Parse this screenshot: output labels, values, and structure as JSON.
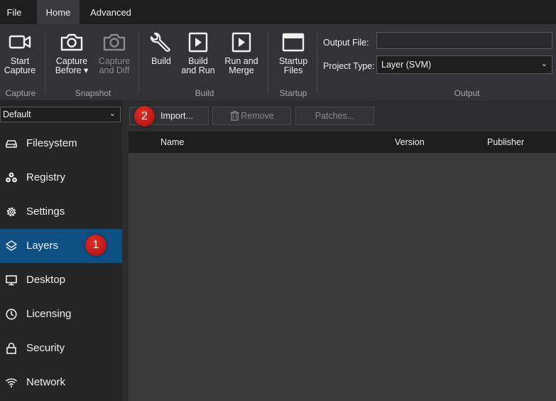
{
  "menu": {
    "tabs": [
      "File",
      "Home",
      "Advanced"
    ]
  },
  "ribbon": {
    "capture": {
      "start_line1": "Start",
      "start_line2": "Capture",
      "group": "Capture"
    },
    "snapshot": {
      "before_line1": "Capture",
      "before_line2": "Before ▾",
      "diff_line1": "Capture",
      "diff_line2": "and Diff",
      "group": "Snapshot"
    },
    "build": {
      "build": "Build",
      "build_run_line1": "Build",
      "build_run_line2": "and Run",
      "run_merge_line1": "Run and",
      "run_merge_line2": "Merge",
      "group": "Build"
    },
    "startup": {
      "line1": "Startup",
      "line2": "Files",
      "group": "Startup"
    },
    "output": {
      "file_label": "Output File:",
      "file_value": "",
      "type_label": "Project Type:",
      "type_value": "Layer (SVM)",
      "group": "Output"
    }
  },
  "sidebar": {
    "dropdown": "Default",
    "items": [
      {
        "label": "Filesystem",
        "icon": "drive-icon"
      },
      {
        "label": "Registry",
        "icon": "registry-icon"
      },
      {
        "label": "Settings",
        "icon": "gear-icon"
      },
      {
        "label": "Layers",
        "icon": "layers-icon",
        "active": true
      },
      {
        "label": "Desktop",
        "icon": "desktop-icon"
      },
      {
        "label": "Licensing",
        "icon": "clock-icon"
      },
      {
        "label": "Security",
        "icon": "lock-icon"
      },
      {
        "label": "Network",
        "icon": "wifi-icon"
      }
    ]
  },
  "toolbar": {
    "import": "Import...",
    "remove": "Remove",
    "patches": "Patches..."
  },
  "table": {
    "columns": [
      "Name",
      "Version",
      "Publisher"
    ]
  },
  "annotations": {
    "badge1": "1",
    "badge2": "2"
  },
  "colors": {
    "accent": "#0e4f84",
    "badge": "#c4161c"
  }
}
